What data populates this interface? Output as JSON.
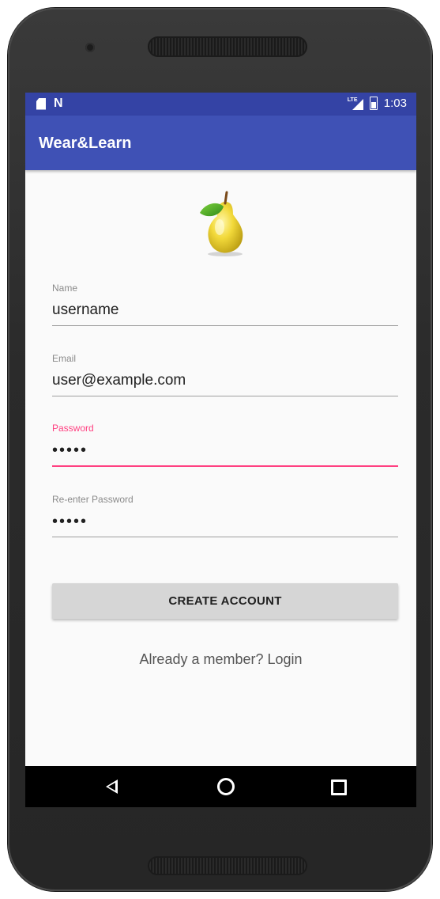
{
  "status_bar": {
    "time": "1:03",
    "network_label": "LTE"
  },
  "app_bar": {
    "title": "Wear&Learn"
  },
  "form": {
    "name": {
      "label": "Name",
      "value": "username"
    },
    "email": {
      "label": "Email",
      "value": "user@example.com"
    },
    "password": {
      "label": "Password",
      "value": "•••••"
    },
    "reenter_password": {
      "label": "Re-enter Password",
      "value": "•••••"
    }
  },
  "actions": {
    "create_account": "CREATE ACCOUNT",
    "login_link": "Already a member? Login"
  },
  "colors": {
    "primary": "#3f51b5",
    "primary_dark": "#3443a5",
    "accent": "#ff4081",
    "button": "#d6d6d6"
  }
}
